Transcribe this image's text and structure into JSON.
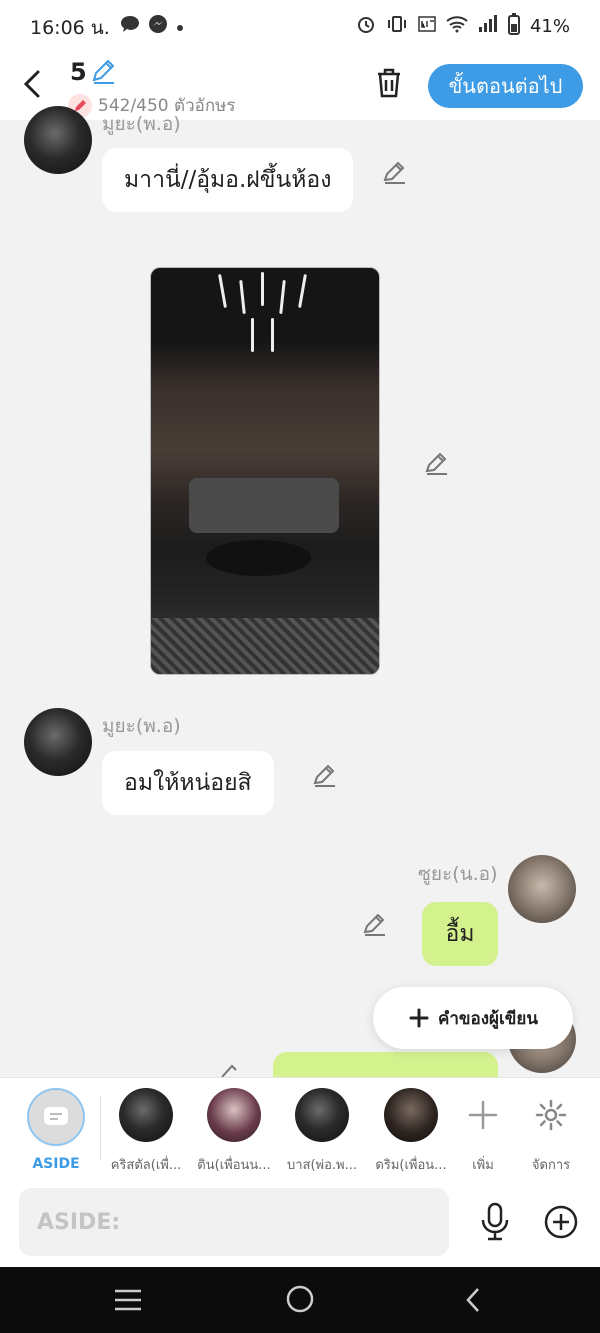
{
  "status_bar": {
    "time": "16:06 น.",
    "battery": "41%"
  },
  "header": {
    "chapter_number": "5",
    "char_count": "542/450 ตัวอักษร",
    "next_button": "ขั้นตอนต่อไป"
  },
  "messages": [
    {
      "speaker": "มูยะ(พ.อ)",
      "text": "มาานี่//อุ้มอ.ฝขึ้นห้อง"
    },
    {
      "speaker": "มูยะ(พ.อ)",
      "text": "อมให้หน่อยสิ"
    },
    {
      "speaker": "ซูยะ(น.อ)",
      "text": "อื้ม"
    }
  ],
  "floating_button": {
    "label": "คำของผู้เขียน"
  },
  "characters": [
    {
      "label": "ASIDE"
    },
    {
      "label": "คริสตัล(เพื่..."
    },
    {
      "label": "ติน(เพื่อนน..."
    },
    {
      "label": "บาส(พ่อ.พ..."
    },
    {
      "label": "ดริม(เพื่อน..."
    },
    {
      "label": "เพิ่ม"
    },
    {
      "label": "จัดการ"
    }
  ],
  "input": {
    "placeholder": "ASIDE:"
  },
  "colors": {
    "accent": "#3e9ce6",
    "green_bubble": "#d3f18d"
  }
}
